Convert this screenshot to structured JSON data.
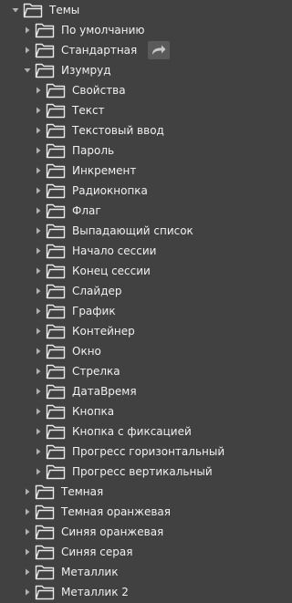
{
  "tree": {
    "root": {
      "label": "Темы",
      "expanded": true,
      "icon": "folder-icon"
    },
    "level1_top": [
      {
        "label": "По умолчанию",
        "expanded": false
      },
      {
        "label": "Стандартная",
        "expanded": false,
        "action_icon": "redo-arrow-icon"
      },
      {
        "label": "Изумруд",
        "expanded": true
      }
    ],
    "izumrud_children": [
      "Свойства",
      "Текст",
      "Текстовый ввод",
      "Пароль",
      "Инкремент",
      "Радиокнопка",
      "Флаг",
      "Выпадающий список",
      "Начало сессии",
      "Конец сессии",
      "Слайдер",
      "График",
      "Контейнер",
      "Окно",
      "Стрелка",
      "ДатаВремя",
      "Кнопка",
      "Кнопка с фиксацией",
      "Прогресс горизонтальный",
      "Прогресс вертикальный"
    ],
    "level1_bottom": [
      "Темная",
      "Темная оранжевая",
      "Синяя оранжевая",
      "Синяя серая",
      "Металлик",
      "Металлик 2"
    ]
  },
  "colors": {
    "background": "#414141",
    "text": "#f0f0f0",
    "icon": "#e8e8e8",
    "arrow": "#b0b0b0"
  }
}
